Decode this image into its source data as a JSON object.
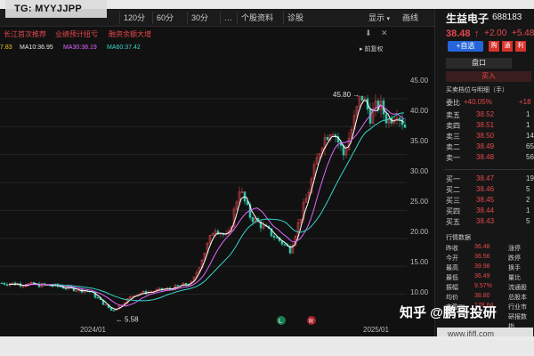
{
  "watermark_top": "TG: MYYJJPP",
  "toolbar": {
    "tabs": [
      "120分",
      "60分",
      "30分",
      "…",
      "个股资料",
      "诊股"
    ],
    "right_tabs": [
      "显示",
      "画线"
    ]
  },
  "subtabs": [
    "长江首次推荐",
    "业绩预计扭亏",
    "融资余额大增"
  ],
  "indicators": {
    "first_value": "7.83",
    "ma10": "MA10:36.95",
    "ma30": "MA30:38.19",
    "ma60": "MA60:37.42",
    "adjust": "前复权"
  },
  "chart_data": {
    "type": "candlestick",
    "yticks": [
      "45.00",
      "40.00",
      "35.00",
      "30.00",
      "25.00",
      "20.00",
      "15.00",
      "10.00"
    ],
    "ylim": [
      5,
      48
    ],
    "xticks": [
      "2024/01",
      "2025/01"
    ],
    "annotations": {
      "high": "45.80",
      "low": "5.58"
    },
    "markers": [
      "L",
      "R"
    ],
    "colors": {
      "up": "#e5484d",
      "down": "#2ec4a6",
      "ma10": "#ffffff",
      "ma30": "#e066ff",
      "ma60": "#38d6c8"
    }
  },
  "stock": {
    "name": "生益电子",
    "code": "688183",
    "price": "38.48",
    "change": "+2.00",
    "pct": "+5.48%",
    "add_fav": "+自选",
    "btns": [
      "购",
      "通",
      "利"
    ]
  },
  "panel": {
    "section": "盘口",
    "buy_label": "买入",
    "orderbook_title": "买卖档位与明细（手）",
    "weibi_label": "委比",
    "weibi_value": "+40.05%",
    "weibi_extra": "+18",
    "asks": [
      {
        "label": "卖五",
        "price": "38.52",
        "vol": "1"
      },
      {
        "label": "卖四",
        "price": "38.51",
        "vol": "1"
      },
      {
        "label": "卖三",
        "price": "38.50",
        "vol": "14"
      },
      {
        "label": "卖二",
        "price": "38.49",
        "vol": "65"
      },
      {
        "label": "卖一",
        "price": "38.48",
        "vol": "56"
      }
    ],
    "bids": [
      {
        "label": "买一",
        "price": "38.47",
        "vol": "194"
      },
      {
        "label": "买二",
        "price": "38.46",
        "vol": "5"
      },
      {
        "label": "买三",
        "price": "38.45",
        "vol": "2"
      },
      {
        "label": "买四",
        "price": "38.44",
        "vol": "1"
      },
      {
        "label": "买五",
        "price": "38.43",
        "vol": "5"
      }
    ],
    "stats_title": "行情数据",
    "stats": [
      {
        "l1": "昨收",
        "v1": "36.48",
        "l2": "涨停"
      },
      {
        "l1": "今开",
        "v1": "36.56",
        "l2": "跌停"
      },
      {
        "l1": "最高",
        "v1": "39.98",
        "l2": "换手"
      },
      {
        "l1": "最低",
        "v1": "36.49",
        "l2": "量比"
      },
      {
        "l1": "振幅",
        "v1": "9.57%",
        "l2": "流通股"
      },
      {
        "l1": "均价",
        "v1": "38.80",
        "l2": "总股本"
      },
      {
        "l1": "市盈™",
        "v1": "178.64",
        "l2": "行业市"
      },
      {
        "l1": "",
        "v1": "",
        "l2": "研报数"
      },
      {
        "l1": "",
        "v1": "",
        "l2": "指"
      }
    ]
  },
  "bottom_watermark": {
    "line1": "知乎 @鹏哥投研",
    "line2": "www.ififl.com"
  }
}
